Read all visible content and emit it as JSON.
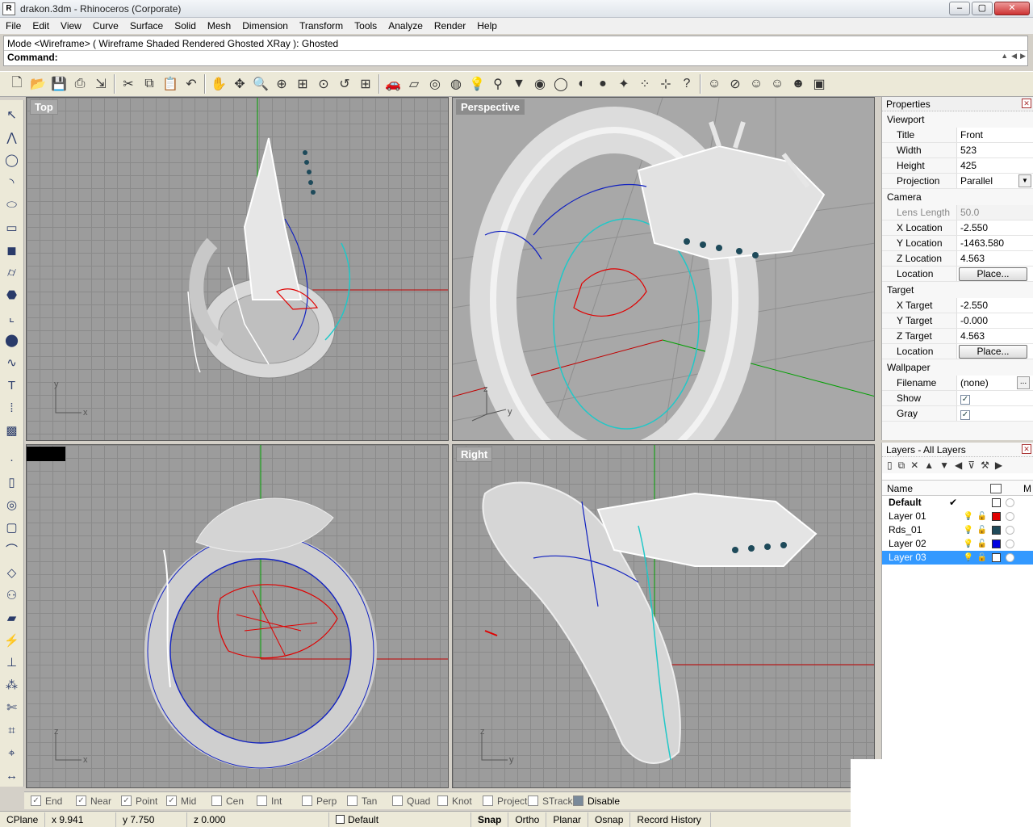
{
  "window": {
    "title": "drakon.3dm - Rhinoceros (Corporate)",
    "app_icon": "rhino-icon",
    "buttons": {
      "minimize": "–",
      "maximize": "▢",
      "close": "✕"
    }
  },
  "menu": [
    "File",
    "Edit",
    "View",
    "Curve",
    "Surface",
    "Solid",
    "Mesh",
    "Dimension",
    "Transform",
    "Tools",
    "Analyze",
    "Render",
    "Help"
  ],
  "command_area": {
    "mode_line": "Mode <Wireframe> ( Wireframe  Shaded  Rendered  Ghosted  XRay ): Ghosted",
    "prompt": "Command:",
    "value": ""
  },
  "toolbar_icons": [
    "new-icon",
    "open-icon",
    "save-icon",
    "print-icon",
    "import-icon",
    "cut-icon",
    "copy-icon",
    "paste-icon",
    "undo-icon",
    "pan-icon",
    "rotate-view-icon",
    "zoom-icon",
    "zoom-window-icon",
    "zoom-extents-icon",
    "zoom-selected-icon",
    "undo-view-icon",
    "four-views-icon",
    "car-icon",
    "plane-icon",
    "select-icon",
    "cplane-icon",
    "bulb-icon",
    "light-icon",
    "paint-icon",
    "color-wheel-icon",
    "wireframe-sphere-icon",
    "shaded-sphere-icon",
    "rendered-sphere-icon",
    "render-icon",
    "points-icon",
    "transform-icon",
    "help-icon",
    "display-mode-1-icon",
    "display-mode-2-icon",
    "display-mode-3-icon",
    "display-mode-4-icon",
    "display-mode-5-icon",
    "display-mode-6-icon"
  ],
  "left_toolbar_icons": [
    "select-arrow-icon",
    "polyline-icon",
    "circle-icon",
    "arc-icon",
    "ellipse-icon",
    "rectangle-icon",
    "box-icon",
    "cylinder-icon",
    "boolean-icon",
    "fillet-icon",
    "solid-sphere-icon",
    "curve-tool-icon",
    "text-icon",
    "array-icon",
    "box-solid-icon",
    "point-icon",
    "rectangle2-icon",
    "ellipse2-icon",
    "rectangle3-icon",
    "curve-edit-icon",
    "surface-icon",
    "spheres-icon",
    "plane-surface-icon",
    "sweep-icon",
    "extrude-icon",
    "group-icon",
    "trim-icon",
    "split-icon",
    "project-icon",
    "dimension-icon"
  ],
  "viewports": {
    "top": {
      "label": "Top",
      "axis_x": "x",
      "axis_y": "y"
    },
    "perspective": {
      "label": "Perspective",
      "axis_z": "z",
      "axis_y": "y"
    },
    "front": {
      "label": "",
      "axis_x": "x",
      "axis_z": "z"
    },
    "right": {
      "label": "Right",
      "axis_y": "y",
      "axis_z": "z"
    }
  },
  "properties": {
    "title": "Properties",
    "section": "Viewport",
    "rows": [
      {
        "key": "Title",
        "value": "Front"
      },
      {
        "key": "Width",
        "value": "523"
      },
      {
        "key": "Height",
        "value": "425"
      },
      {
        "key": "Projection",
        "value": "Parallel"
      }
    ],
    "camera_label": "Camera",
    "camera": [
      {
        "key": "Lens Length",
        "value": "50.0",
        "disabled": true
      },
      {
        "key": "X Location",
        "value": "-2.550"
      },
      {
        "key": "Y Location",
        "value": "-1463.580"
      },
      {
        "key": "Z Location",
        "value": "4.563"
      },
      {
        "key": "Location",
        "button": "Place..."
      }
    ],
    "target_label": "Target",
    "target": [
      {
        "key": "X Target",
        "value": "-2.550"
      },
      {
        "key": "Y Target",
        "value": "-0.000"
      },
      {
        "key": "Z Target",
        "value": "4.563"
      },
      {
        "key": "Location",
        "button": "Place..."
      }
    ],
    "wallpaper_label": "Wallpaper",
    "wallpaper": [
      {
        "key": "Filename",
        "value": "(none)",
        "dots": "..."
      },
      {
        "key": "Show",
        "checked": true
      },
      {
        "key": "Gray",
        "checked": true
      }
    ]
  },
  "layers": {
    "title": "Layers - All Layers",
    "columns": {
      "name": "Name",
      "material": "M"
    },
    "rows": [
      {
        "name": "Default",
        "current": true,
        "bold": true,
        "color": "#ffffff",
        "selected": false
      },
      {
        "name": "Layer 01",
        "color": "#e00000",
        "selected": false
      },
      {
        "name": "Rds_01",
        "color": "#1e4a5a",
        "selected": false
      },
      {
        "name": "Layer 02",
        "color": "#0000e0",
        "selected": false
      },
      {
        "name": "Layer 03",
        "color": "#ffffff",
        "selected": true
      }
    ]
  },
  "osnap": [
    {
      "label": "End",
      "checked": true
    },
    {
      "label": "Near",
      "checked": true
    },
    {
      "label": "Point",
      "checked": true
    },
    {
      "label": "Mid",
      "checked": true
    },
    {
      "label": "Cen",
      "checked": false
    },
    {
      "label": "Int",
      "checked": false
    },
    {
      "label": "Perp",
      "checked": false
    },
    {
      "label": "Tan",
      "checked": false
    },
    {
      "label": "Quad",
      "checked": false
    },
    {
      "label": "Knot",
      "checked": false
    },
    {
      "label": "Project",
      "checked": false
    },
    {
      "label": "STrack",
      "checked": false
    }
  ],
  "osnap_disable": "Disable",
  "status": {
    "cplane": "CPlane",
    "x": "x 9.941",
    "y": "y 7.750",
    "z": "z 0.000",
    "layer": "Default",
    "snap": "Snap",
    "ortho": "Ortho",
    "planar": "Planar",
    "osnap": "Osnap",
    "history": "Record History"
  },
  "colors": {
    "viewport_bg": "#9c9c9c",
    "grid": "#8a8a8a",
    "selection": "#3399ff",
    "curve_red": "#e00000",
    "curve_blue": "#1020c0",
    "curve_cyan": "#20c8c8"
  }
}
